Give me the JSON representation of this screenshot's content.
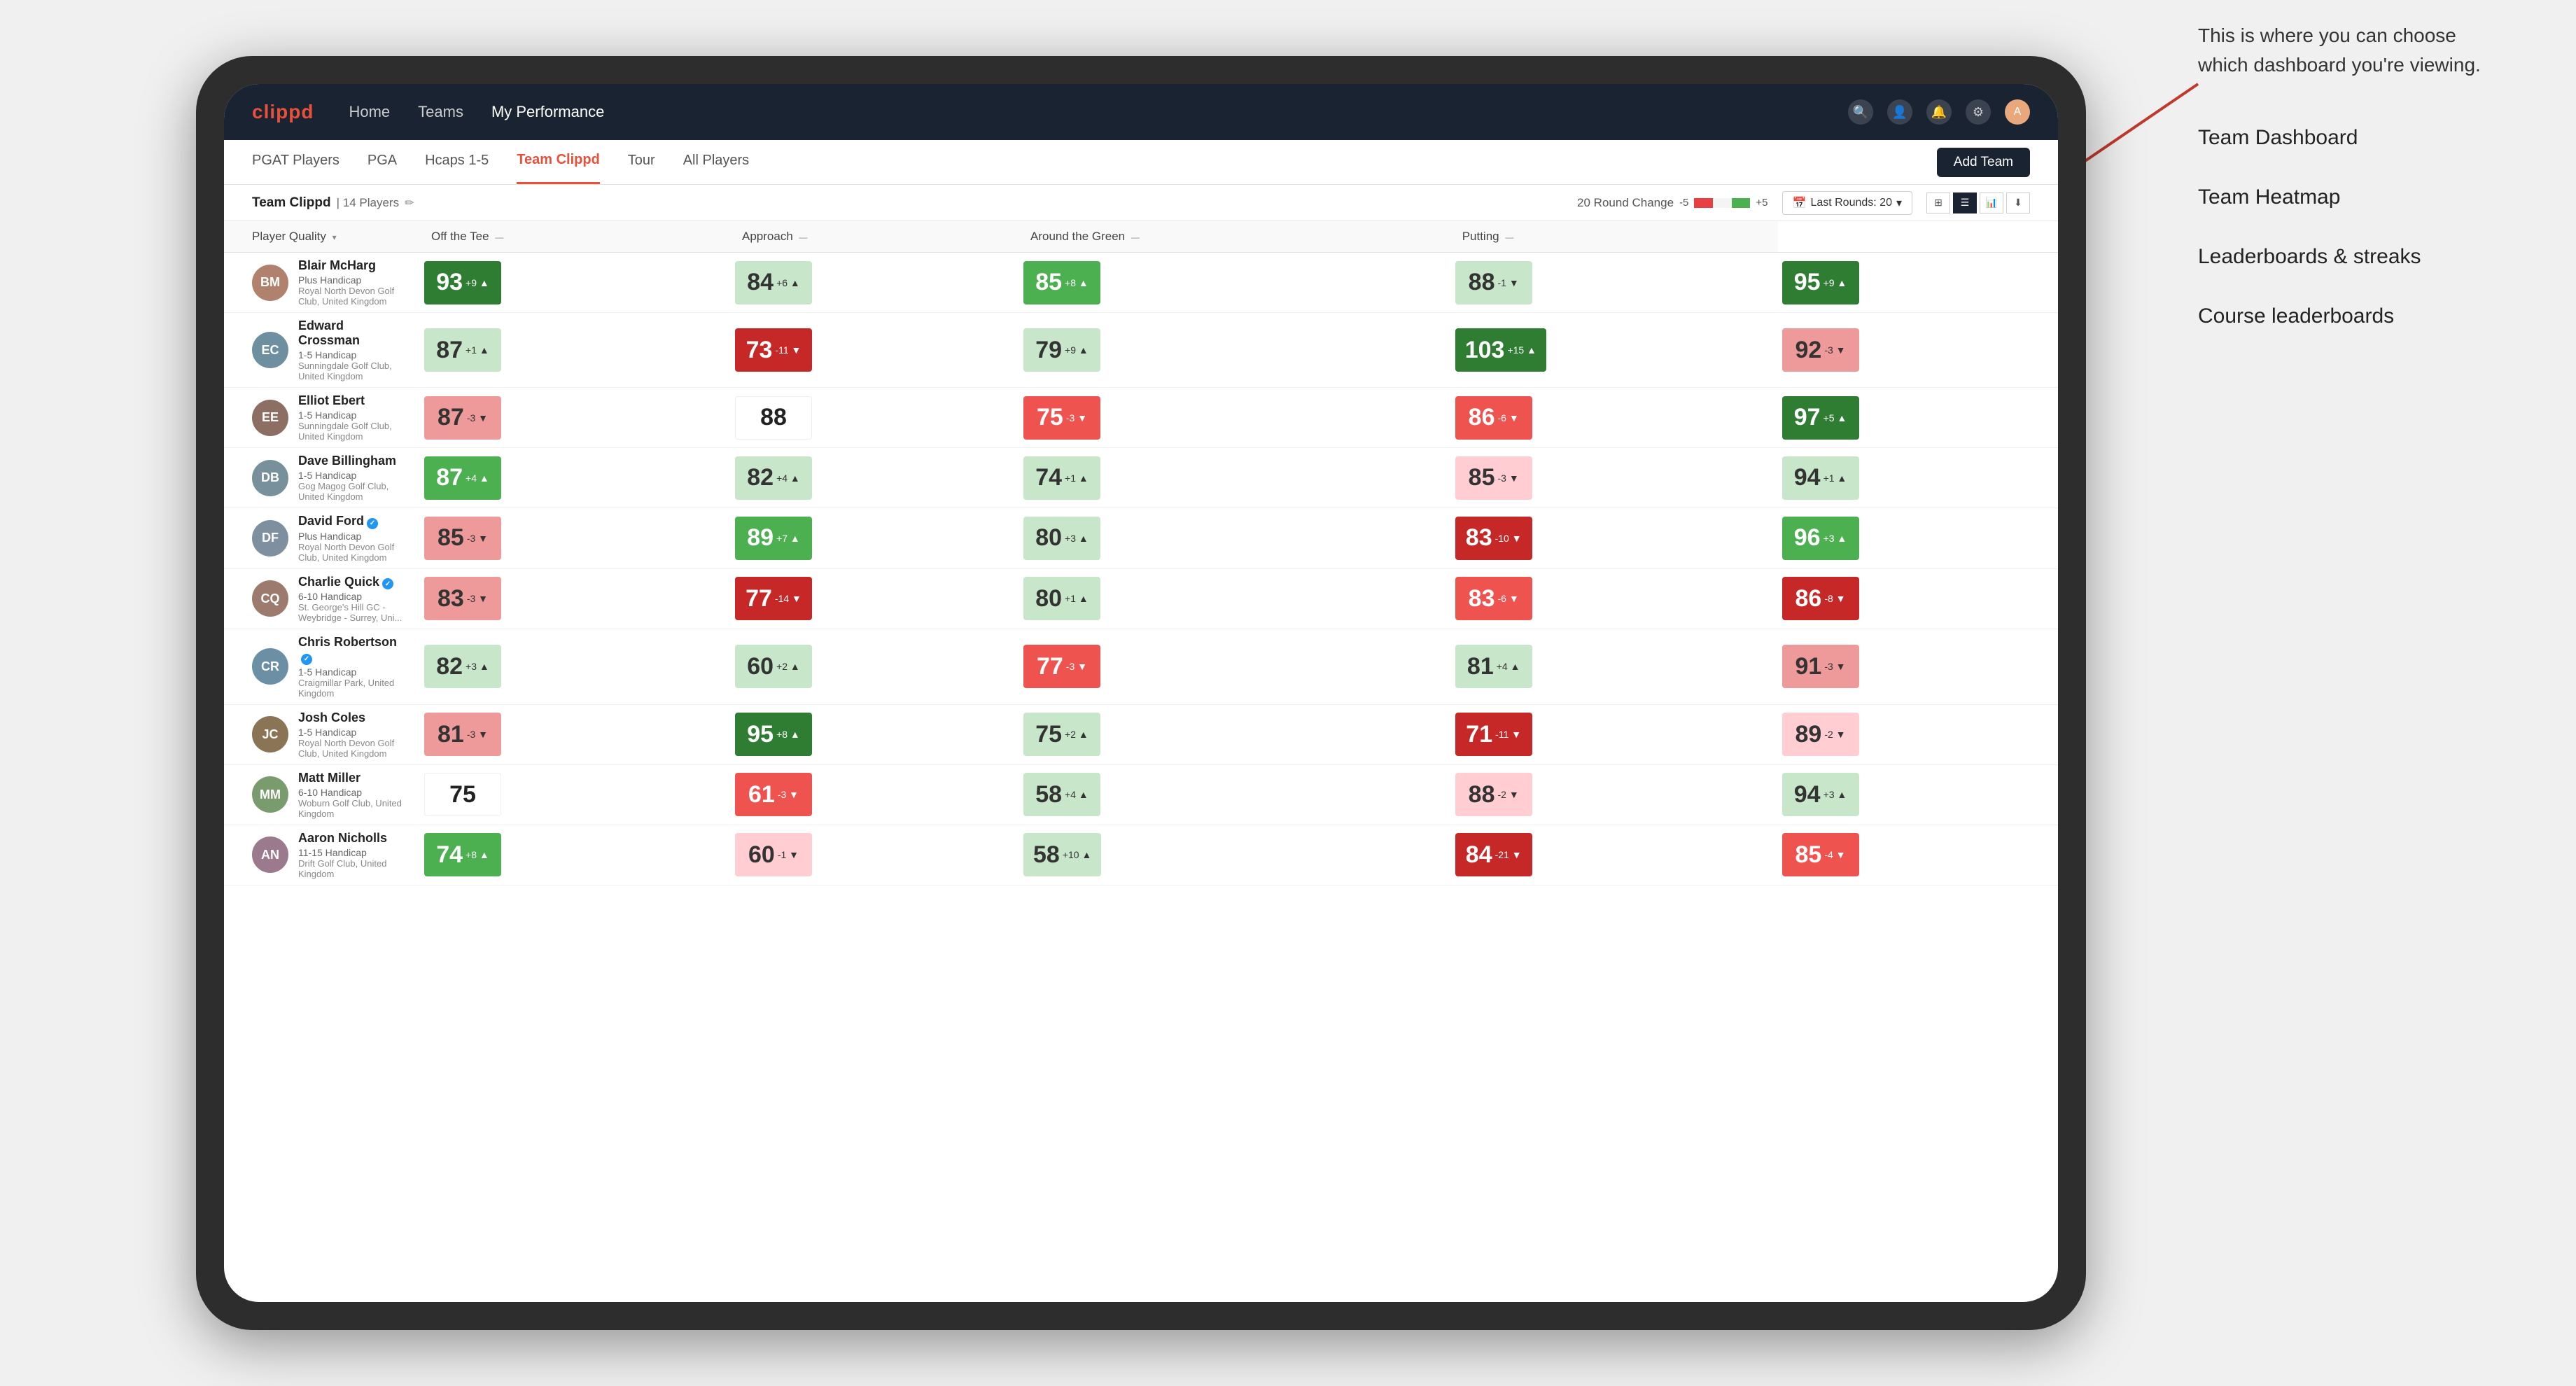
{
  "annotation": {
    "intro": "This is where you can choose which dashboard you're viewing.",
    "items": [
      "Team Dashboard",
      "Team Heatmap",
      "Leaderboards & streaks",
      "Course leaderboards"
    ]
  },
  "navbar": {
    "logo": "clippd",
    "nav_items": [
      "Home",
      "Teams",
      "My Performance"
    ],
    "active_nav": "My Performance"
  },
  "subtabs": {
    "tabs": [
      "PGAT Players",
      "PGA",
      "Hcaps 1-5",
      "Team Clippd",
      "Tour",
      "All Players"
    ],
    "active": "Team Clippd",
    "add_team_label": "Add Team"
  },
  "team_bar": {
    "team_name": "Team Clippd",
    "player_count": "14 Players",
    "round_change_label": "20 Round Change",
    "minus_label": "-5",
    "plus_label": "+5",
    "last_rounds_label": "Last Rounds: 20"
  },
  "table": {
    "headers": {
      "player": "Player Quality",
      "off_tee": "Off the Tee",
      "approach": "Approach",
      "around_green": "Around the Green",
      "putting": "Putting"
    },
    "players": [
      {
        "name": "Blair McHarg",
        "handicap": "Plus Handicap",
        "club": "Royal North Devon Golf Club, United Kingdom",
        "verified": false,
        "scores": {
          "player_quality": {
            "val": 93,
            "change": "+9",
            "dir": "up",
            "color": "green-dark"
          },
          "off_tee": {
            "val": 84,
            "change": "+6",
            "dir": "up",
            "color": "light-green"
          },
          "approach": {
            "val": 85,
            "change": "+8",
            "dir": "up",
            "color": "green-mid"
          },
          "around_green": {
            "val": 88,
            "change": "-1",
            "dir": "down",
            "color": "light-green"
          },
          "putting": {
            "val": 95,
            "change": "+9",
            "dir": "up",
            "color": "green-dark"
          }
        }
      },
      {
        "name": "Edward Crossman",
        "handicap": "1-5 Handicap",
        "club": "Sunningdale Golf Club, United Kingdom",
        "verified": false,
        "scores": {
          "player_quality": {
            "val": 87,
            "change": "+1",
            "dir": "up",
            "color": "light-green"
          },
          "off_tee": {
            "val": 73,
            "change": "-11",
            "dir": "down",
            "color": "red-dark"
          },
          "approach": {
            "val": 79,
            "change": "+9",
            "dir": "up",
            "color": "light-green"
          },
          "around_green": {
            "val": 103,
            "change": "+15",
            "dir": "up",
            "color": "green-dark"
          },
          "putting": {
            "val": 92,
            "change": "-3",
            "dir": "down",
            "color": "red-light"
          }
        }
      },
      {
        "name": "Elliot Ebert",
        "handicap": "1-5 Handicap",
        "club": "Sunningdale Golf Club, United Kingdom",
        "verified": false,
        "scores": {
          "player_quality": {
            "val": 87,
            "change": "-3",
            "dir": "down",
            "color": "red-light"
          },
          "off_tee": {
            "val": 88,
            "change": "",
            "dir": "",
            "color": "neutral"
          },
          "approach": {
            "val": 75,
            "change": "-3",
            "dir": "down",
            "color": "red-mid"
          },
          "around_green": {
            "val": 86,
            "change": "-6",
            "dir": "down",
            "color": "red-mid"
          },
          "putting": {
            "val": 97,
            "change": "+5",
            "dir": "up",
            "color": "green-dark"
          }
        }
      },
      {
        "name": "Dave Billingham",
        "handicap": "1-5 Handicap",
        "club": "Gog Magog Golf Club, United Kingdom",
        "verified": false,
        "scores": {
          "player_quality": {
            "val": 87,
            "change": "+4",
            "dir": "up",
            "color": "green-mid"
          },
          "off_tee": {
            "val": 82,
            "change": "+4",
            "dir": "up",
            "color": "light-green"
          },
          "approach": {
            "val": 74,
            "change": "+1",
            "dir": "up",
            "color": "light-green"
          },
          "around_green": {
            "val": 85,
            "change": "-3",
            "dir": "down",
            "color": "light-red"
          },
          "putting": {
            "val": 94,
            "change": "+1",
            "dir": "up",
            "color": "light-green"
          }
        }
      },
      {
        "name": "David Ford",
        "handicap": "Plus Handicap",
        "club": "Royal North Devon Golf Club, United Kingdom",
        "verified": true,
        "scores": {
          "player_quality": {
            "val": 85,
            "change": "-3",
            "dir": "down",
            "color": "red-light"
          },
          "off_tee": {
            "val": 89,
            "change": "+7",
            "dir": "up",
            "color": "green-mid"
          },
          "approach": {
            "val": 80,
            "change": "+3",
            "dir": "up",
            "color": "light-green"
          },
          "around_green": {
            "val": 83,
            "change": "-10",
            "dir": "down",
            "color": "red-dark"
          },
          "putting": {
            "val": 96,
            "change": "+3",
            "dir": "up",
            "color": "green-mid"
          }
        }
      },
      {
        "name": "Charlie Quick",
        "handicap": "6-10 Handicap",
        "club": "St. George's Hill GC - Weybridge - Surrey, Uni...",
        "verified": true,
        "scores": {
          "player_quality": {
            "val": 83,
            "change": "-3",
            "dir": "down",
            "color": "red-light"
          },
          "off_tee": {
            "val": 77,
            "change": "-14",
            "dir": "down",
            "color": "red-dark"
          },
          "approach": {
            "val": 80,
            "change": "+1",
            "dir": "up",
            "color": "light-green"
          },
          "around_green": {
            "val": 83,
            "change": "-6",
            "dir": "down",
            "color": "red-mid"
          },
          "putting": {
            "val": 86,
            "change": "-8",
            "dir": "down",
            "color": "red-dark"
          }
        }
      },
      {
        "name": "Chris Robertson",
        "handicap": "1-5 Handicap",
        "club": "Craigmillar Park, United Kingdom",
        "verified": true,
        "scores": {
          "player_quality": {
            "val": 82,
            "change": "+3",
            "dir": "up",
            "color": "light-green"
          },
          "off_tee": {
            "val": 60,
            "change": "+2",
            "dir": "up",
            "color": "light-green"
          },
          "approach": {
            "val": 77,
            "change": "-3",
            "dir": "down",
            "color": "red-mid"
          },
          "around_green": {
            "val": 81,
            "change": "+4",
            "dir": "up",
            "color": "light-green"
          },
          "putting": {
            "val": 91,
            "change": "-3",
            "dir": "down",
            "color": "red-light"
          }
        }
      },
      {
        "name": "Josh Coles",
        "handicap": "1-5 Handicap",
        "club": "Royal North Devon Golf Club, United Kingdom",
        "verified": false,
        "scores": {
          "player_quality": {
            "val": 81,
            "change": "-3",
            "dir": "down",
            "color": "red-light"
          },
          "off_tee": {
            "val": 95,
            "change": "+8",
            "dir": "up",
            "color": "green-dark"
          },
          "approach": {
            "val": 75,
            "change": "+2",
            "dir": "up",
            "color": "light-green"
          },
          "around_green": {
            "val": 71,
            "change": "-11",
            "dir": "down",
            "color": "red-dark"
          },
          "putting": {
            "val": 89,
            "change": "-2",
            "dir": "down",
            "color": "light-red"
          }
        }
      },
      {
        "name": "Matt Miller",
        "handicap": "6-10 Handicap",
        "club": "Woburn Golf Club, United Kingdom",
        "verified": false,
        "scores": {
          "player_quality": {
            "val": 75,
            "change": "",
            "dir": "",
            "color": "neutral"
          },
          "off_tee": {
            "val": 61,
            "change": "-3",
            "dir": "down",
            "color": "red-mid"
          },
          "approach": {
            "val": 58,
            "change": "+4",
            "dir": "up",
            "color": "light-green"
          },
          "around_green": {
            "val": 88,
            "change": "-2",
            "dir": "down",
            "color": "light-red"
          },
          "putting": {
            "val": 94,
            "change": "+3",
            "dir": "up",
            "color": "light-green"
          }
        }
      },
      {
        "name": "Aaron Nicholls",
        "handicap": "11-15 Handicap",
        "club": "Drift Golf Club, United Kingdom",
        "verified": false,
        "scores": {
          "player_quality": {
            "val": 74,
            "change": "+8",
            "dir": "up",
            "color": "green-mid"
          },
          "off_tee": {
            "val": 60,
            "change": "-1",
            "dir": "down",
            "color": "light-red"
          },
          "approach": {
            "val": 58,
            "change": "+10",
            "dir": "up",
            "color": "light-green"
          },
          "around_green": {
            "val": 84,
            "change": "-21",
            "dir": "down",
            "color": "red-dark"
          },
          "putting": {
            "val": 85,
            "change": "-4",
            "dir": "down",
            "color": "red-mid"
          }
        }
      }
    ]
  }
}
